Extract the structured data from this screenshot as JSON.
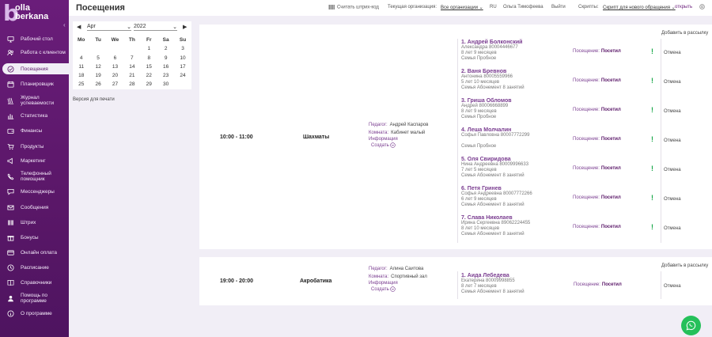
{
  "brand": {
    "letter": "b",
    "line1": "olla",
    "line2": "berkana"
  },
  "sidebar": {
    "items": [
      {
        "label": "Рабочий стол",
        "icon": "monitor-icon"
      },
      {
        "label": "Работа с клиентом",
        "icon": "users-icon"
      },
      {
        "label": "Посещения",
        "icon": "checkmark-icon",
        "active": true
      },
      {
        "label": "Планировщик",
        "icon": "calendar-icon"
      },
      {
        "label": "Журнал успеваемости",
        "icon": "journal-icon"
      },
      {
        "label": "Статистика",
        "icon": "chart-icon"
      },
      {
        "label": "Финансы",
        "icon": "wallet-icon"
      },
      {
        "label": "Продукты",
        "icon": "cart-icon"
      },
      {
        "label": "Маркетинг",
        "icon": "megaphone-icon"
      },
      {
        "label": "Телефонный помощник",
        "icon": "phone-icon"
      },
      {
        "label": "Мессенджеры",
        "icon": "chat-icon"
      },
      {
        "label": "Сообщения",
        "icon": "envelope-icon"
      },
      {
        "label": "Штрих",
        "icon": "barcode-icon"
      },
      {
        "label": "Бонусы",
        "icon": "gift-icon"
      },
      {
        "label": "Онлайн оплата",
        "icon": "card-icon"
      },
      {
        "label": "Расписание",
        "icon": "clock-icon"
      },
      {
        "label": "Справочники",
        "icon": "book-icon"
      },
      {
        "label": "Помощь по программе",
        "icon": "help-icon"
      },
      {
        "label": "О программе",
        "icon": "info-icon"
      }
    ]
  },
  "header": {
    "title": "Посещения",
    "scan": "Считать штрих-код",
    "org_label": "Текущая организация:",
    "org_value": "Все организации",
    "lang": "RU",
    "user": "Ольга Тимофеева",
    "logout": "Выйти",
    "scripts_label": "Скрипты:",
    "scripts_value": "Скрипт для нового обращения",
    "open": "открыть"
  },
  "calendar": {
    "month": "Apr",
    "year": "2022",
    "weekdays": [
      "Mo",
      "Tu",
      "We",
      "Th",
      "Fr",
      "Sa",
      "Su"
    ],
    "weeks": [
      [
        "",
        "",
        "",
        "",
        "1",
        "2",
        "3"
      ],
      [
        "4",
        "5",
        "6",
        "7",
        "8",
        "9",
        "10"
      ],
      [
        "11",
        "12",
        "13",
        "14",
        "15",
        "16",
        "17"
      ],
      [
        "18",
        "19",
        "20",
        "21",
        "22",
        "23",
        "24"
      ],
      [
        "25",
        "26",
        "27",
        "28",
        "29",
        "30",
        ""
      ]
    ],
    "print": "Версия для печати"
  },
  "lessons": [
    {
      "time": "10:00 - 11:00",
      "subject": "Шахматы",
      "teacher_label": "Педагог:",
      "teacher": "Андрей Каспаров",
      "room_label": "Комната:",
      "room": "Кабинет малый",
      "info": "Информация",
      "create": "Создать",
      "add_mail": "Добавить в рассылку",
      "students": [
        {
          "name": "1. Андрей Болконский",
          "line1": "Александра 80004446677",
          "line2": "8 лет 9 месяцев",
          "line3": "Семья  Пробное",
          "visit_label": "Посещение:",
          "visit": "Посетил",
          "cancel": "Отмена"
        },
        {
          "name": "2. Ваня Бревнов",
          "line1": "Антонина 80005559966",
          "line2": "5 лет 10 месяцев",
          "line3": "Семья  Абонемент 8 занятий",
          "visit_label": "Посещение:",
          "visit": "Посетил",
          "cancel": "Отмена"
        },
        {
          "name": "3. Гриша Обломов",
          "line1": "Андрей 80006668899",
          "line2": "8 лет 9 месяцев",
          "line3": "Семья  Пробное",
          "visit_label": "Посещение:",
          "visit": "Посетил",
          "cancel": "Отмена"
        },
        {
          "name": "4. Леша Молчалин",
          "line1": "Софья Павловна 80007772299",
          "line2": "",
          "line3": "Семья  Пробное",
          "visit_label": "Посещение:",
          "visit": "Посетил",
          "cancel": "Отмена"
        },
        {
          "name": "5. Оля Свиридова",
          "line1": "Нина Андреевна 80009996633",
          "line2": "7 лет 5 месяцев",
          "line3": "Семья  Абонемент 8 занятий",
          "visit_label": "Посещение:",
          "visit": "Посетил",
          "cancel": "Отмена"
        },
        {
          "name": "6. Петя Гринев",
          "line1": "Софья Андреевна 80007772266",
          "line2": "6 лет 9 месяцев",
          "line3": "Семья  Абонемент 8 занятий",
          "visit_label": "Посещение:",
          "visit": "Посетил",
          "cancel": "Отмена"
        },
        {
          "name": "7. Слава Николаев",
          "line1": "Ирина Сергеевна 89062224455",
          "line2": "8 лет 10 месяцев",
          "line3": "Семья  Абонемент 8 занятий",
          "visit_label": "Посещение:",
          "visit": "Посетил",
          "cancel": "Отмена"
        }
      ]
    },
    {
      "time": "19:00 - 20:00",
      "subject": "Акробатика",
      "teacher_label": "Педагог:",
      "teacher": "Алина Саитова",
      "room_label": "Комната:",
      "room": "Спортивный зал",
      "info": "Информация",
      "create": "Создать",
      "add_mail": "Добавить в рассылку",
      "students": [
        {
          "name": "1. Аида Лебедева",
          "line1": "Екатерина 80009998855",
          "line2": "8 лет 7 месяцев",
          "line3": "Семья  Абонемент 8 занятий",
          "visit_label": "Посещение:",
          "visit": "Посетил",
          "cancel": "Отмена"
        }
      ]
    }
  ]
}
